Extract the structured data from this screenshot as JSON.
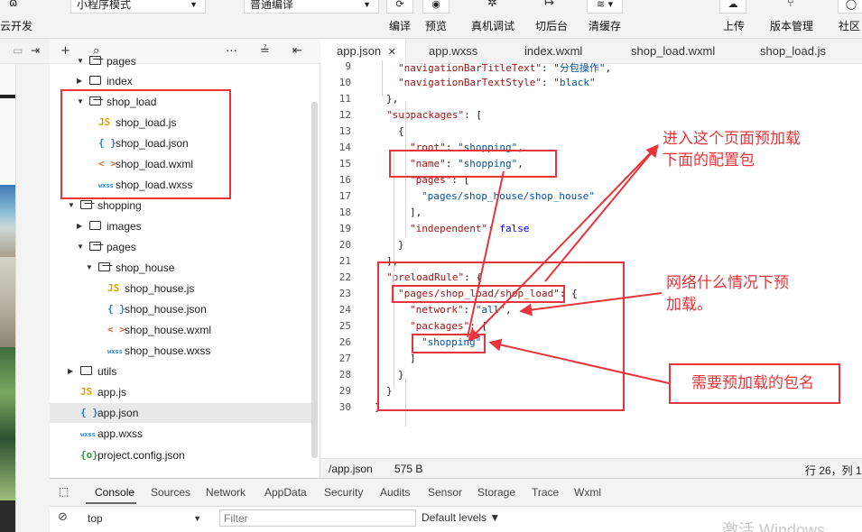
{
  "toolbar": {
    "cloud_dev": "云开发",
    "mode_select": "小程序模式",
    "compile_select": "普通编译",
    "compile": "编译",
    "preview": "预览",
    "device_debug": "真机调试",
    "background": "切后台",
    "clear_cache": "清缓存",
    "upload": "上传",
    "version_mgmt": "版本管理",
    "community": "社区"
  },
  "explorer": {
    "rows": [
      {
        "label": "pages",
        "type": "folder-open"
      },
      {
        "label": "index",
        "type": "folder"
      },
      {
        "label": "shop_load",
        "type": "folder-open"
      },
      {
        "label": "shop_load.js",
        "type": "js"
      },
      {
        "label": "shop_load.json",
        "type": "json"
      },
      {
        "label": "shop_load.wxml",
        "type": "wxml"
      },
      {
        "label": "shop_load.wxss",
        "type": "wxss"
      },
      {
        "label": "shopping",
        "type": "folder-open"
      },
      {
        "label": "images",
        "type": "folder"
      },
      {
        "label": "pages",
        "type": "folder-open"
      },
      {
        "label": "shop_house",
        "type": "folder-open"
      },
      {
        "label": "shop_house.js",
        "type": "js"
      },
      {
        "label": "shop_house.json",
        "type": "json"
      },
      {
        "label": "shop_house.wxml",
        "type": "wxml"
      },
      {
        "label": "shop_house.wxss",
        "type": "wxss"
      },
      {
        "label": "utils",
        "type": "folder"
      },
      {
        "label": "app.js",
        "type": "js"
      },
      {
        "label": "app.json",
        "type": "json"
      },
      {
        "label": "app.wxss",
        "type": "wxss"
      },
      {
        "label": "project.config.json",
        "type": "config"
      }
    ],
    "icons": {
      "js": "JS",
      "json": "{ }",
      "wxml": "< >",
      "wxss": "wxss",
      "config": "{o}"
    }
  },
  "tabs": [
    "app.json",
    "app.wxss",
    "index.wxml",
    "shop_load.wxml",
    "shop_load.js"
  ],
  "code": {
    "line_numbers": [
      "9",
      "10",
      "11",
      "12",
      "13",
      "14",
      "15",
      "16",
      "17",
      "18",
      "19",
      "20",
      "21",
      "22",
      "23",
      "24",
      "25",
      "26",
      "27",
      "28",
      "29",
      "30"
    ],
    "lines": [
      "\"navigationBarTitleText\": \"分包操作\",",
      "\"navigationBarTextStyle\": \"black\"",
      "},",
      "\"subpackages\": [",
      "{",
      "\"root\": \"shopping\",",
      "\"name\": \"shopping\",",
      "\"pages\": [",
      "\"pages/shop_house/shop_house\"",
      "],",
      "\"independent\": false",
      "}",
      "],",
      "\"preloadRule\": {",
      "\"pages/shop_load/shop_load\": {",
      "\"network\": \"all\",",
      "\"packages\": [",
      "\"shopping\"",
      "]",
      "}",
      "}",
      "}"
    ]
  },
  "status": {
    "file": "/app.json",
    "size": "575 B",
    "position": "行 26，列 1"
  },
  "console": {
    "tabs": [
      "Console",
      "Sources",
      "Network",
      "AppData",
      "Security",
      "Audits",
      "Sensor",
      "Storage",
      "Trace",
      "Wxml"
    ],
    "context": "top",
    "filter_placeholder": "Filter",
    "levels": "Default levels ▼"
  },
  "annotations": {
    "preload_page": "进入这个页面预加载\n下面的配置包",
    "network": "网络什么情况下预\n加载。",
    "package_name": "需要预加载的包名"
  },
  "watermark": "激活 Windows",
  "colors": {
    "annotation": "#e8353b",
    "string": "#0451a5",
    "key": "#a31515",
    "keyword": "#0000ff"
  }
}
